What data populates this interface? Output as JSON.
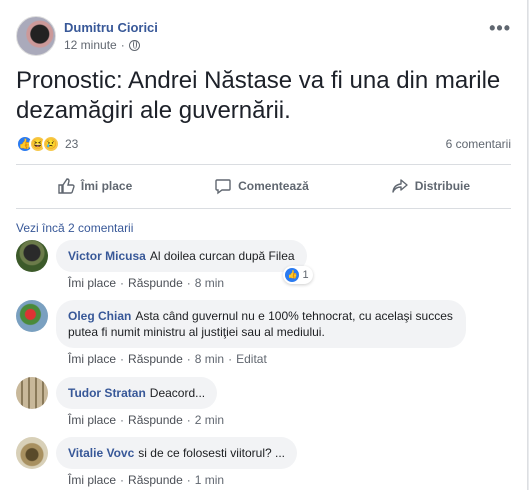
{
  "post": {
    "author": "Dumitru Ciorici",
    "time": "12 minute",
    "more": "•••",
    "text": "Pronostic: Andrei Năstase va fi una din marile dezamăgiri ale guvernării.",
    "reaction_count": "23",
    "comment_count": "6 comentarii"
  },
  "actions": {
    "like": "Îmi place",
    "comment": "Comentează",
    "share": "Distribuie"
  },
  "comments_section": {
    "view_more": "Vezi încă 2 comentarii",
    "like_label": "Îmi place",
    "reply_label": "Răspunde",
    "items": [
      {
        "name": "Victor Micusa",
        "text": "Al doilea curcan după Filea",
        "time": "8 min",
        "likes": "1"
      },
      {
        "name": "Oleg Chian",
        "text": "Asta când guvernul nu e 100% tehnocrat, cu acelaşi succes putea fi numit ministru al justiţiei sau al mediului.",
        "time": "8 min",
        "edited": "Editat"
      },
      {
        "name": "Tudor Stratan",
        "text": "Deacord...",
        "time": "2 min"
      },
      {
        "name": "Vitalie Vovc",
        "text": "si de ce folosesti viitorul? ...",
        "time": "1 min"
      }
    ]
  },
  "colors": {
    "link": "#385898",
    "like_blue": "#2b7bf0",
    "bubble": "#f2f3f5"
  }
}
